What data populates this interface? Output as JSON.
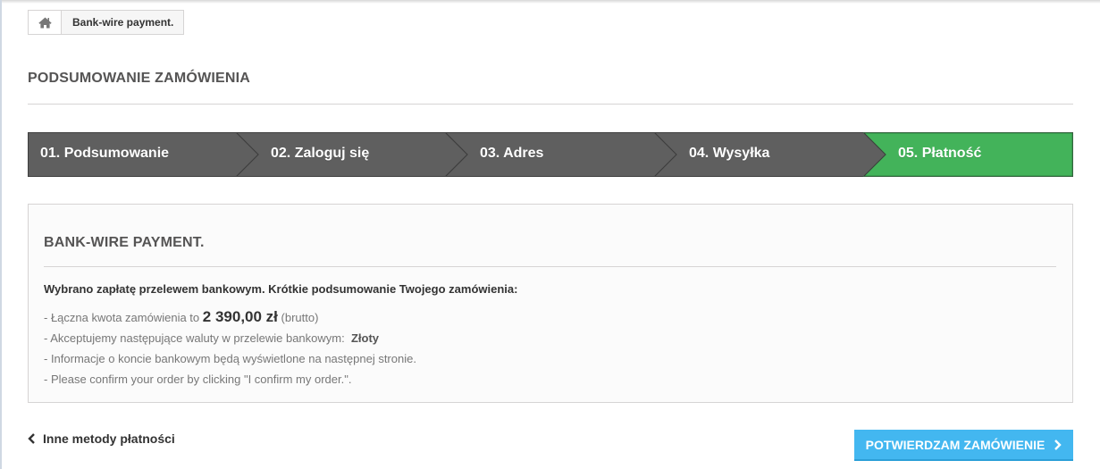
{
  "breadcrumb": {
    "home_icon": "home-icon",
    "current": "Bank-wire payment."
  },
  "page_title": "PODSUMOWANIE ZAMÓWIENIA",
  "steps": [
    {
      "label": "01. Podsumowanie",
      "state": "done"
    },
    {
      "label": "02. Zaloguj się",
      "state": "done"
    },
    {
      "label": "03. Adres",
      "state": "done"
    },
    {
      "label": "04. Wysyłka",
      "state": "done"
    },
    {
      "label": "05. Płatność",
      "state": "current"
    }
  ],
  "colors": {
    "step_done": "#666666",
    "step_current": "#43b35a",
    "accent": "#43b7f0"
  },
  "box": {
    "title": "BANK-WIRE PAYMENT.",
    "intro": "Wybrano zapłatę przelewem bankowym. Krótkie podsumowanie Twojego zamówienia:",
    "total_prefix": "- Łączna kwota zamówienia to",
    "total_amount": "2 390,00 zł",
    "total_suffix": "(brutto)",
    "currency_prefix": "- Akceptujemy następujące waluty w przelewie bankowym:",
    "currency": "Złoty",
    "info_line": "- Informacje o koncie bankowym będą wyświetlone na następnej stronie.",
    "confirm_line": "- Please confirm your order by clicking \"I confirm my order.\"."
  },
  "footer": {
    "back_label": "Inne metody płatności",
    "confirm_label": "POTWIERDZAM ZAMÓWIENIE"
  }
}
